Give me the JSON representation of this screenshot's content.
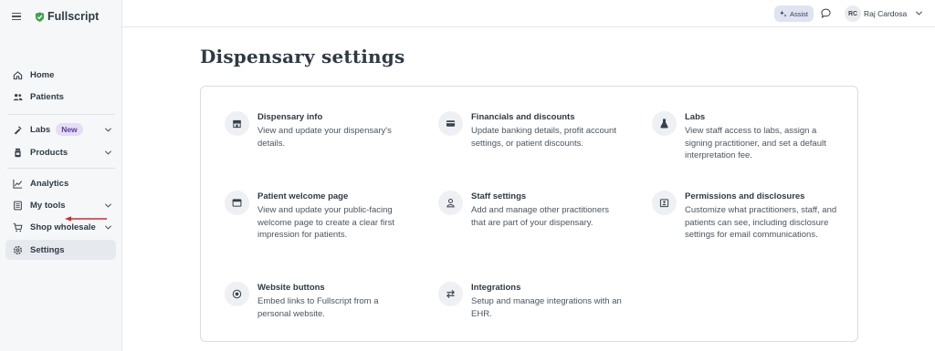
{
  "app": {
    "logo": "Fullscript"
  },
  "sidebar": {
    "items": [
      {
        "label": "Home",
        "icon": "home-icon"
      },
      {
        "label": "Patients",
        "icon": "patients-icon"
      },
      {
        "label": "Labs",
        "icon": "labs-icon",
        "badge": "New"
      },
      {
        "label": "Products",
        "icon": "products-icon"
      },
      {
        "label": "Analytics",
        "icon": "analytics-icon"
      },
      {
        "label": "My tools",
        "icon": "tools-icon"
      },
      {
        "label": "Shop wholesale",
        "icon": "cart-icon"
      },
      {
        "label": "Settings",
        "icon": "gear-icon"
      }
    ],
    "active": "Settings",
    "annotation_color": "#d9252b"
  },
  "topbar": {
    "assist_label": "Assist",
    "user_initials": "RC",
    "user_name": "Raj Cardosa"
  },
  "main": {
    "title": "Dispensary settings",
    "settings": [
      {
        "title": "Dispensary info",
        "desc": "View and update your dispensary's details.",
        "icon": "store-icon"
      },
      {
        "title": "Financials and discounts",
        "desc": "Update banking details, profit account settings, or patient discounts.",
        "icon": "credit-card-icon"
      },
      {
        "title": "Labs",
        "desc": "View staff access to labs, assign a signing practitioner, and set a default interpretation fee.",
        "icon": "flask-icon"
      },
      {
        "title": "Patient welcome page",
        "desc": "View and update your public-facing welcome page to create a clear first impression for patients.",
        "icon": "browser-icon"
      },
      {
        "title": "Staff settings",
        "desc": "Add and manage other practitioners that are part of your dispensary.",
        "icon": "user-icon"
      },
      {
        "title": "Permissions and disclosures",
        "desc": "Customize what practitioners, staff, and patients can see, including disclosure settings for email communications.",
        "icon": "id-badge-icon"
      },
      {
        "title": "Website buttons",
        "desc": "Embed links to Fullscript from a personal website.",
        "icon": "target-icon"
      },
      {
        "title": "Integrations",
        "desc": "Setup and manage integrations with an EHR.",
        "icon": "arrows-swap-icon"
      }
    ]
  },
  "colors": {
    "brand_green": "#3fa34d",
    "sidebar_bg": "#f6f7f8",
    "assist_bg": "#dfe3f2"
  }
}
